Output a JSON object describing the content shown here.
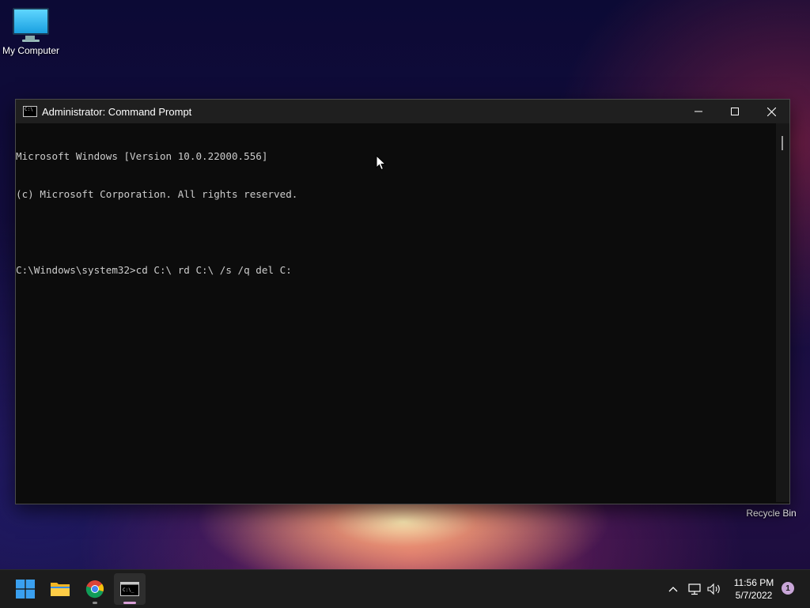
{
  "desktop": {
    "icons": [
      {
        "label": "My Computer",
        "icon": "monitor-icon"
      },
      {
        "label": "Recycle Bin",
        "icon": "recycle-bin-icon"
      }
    ]
  },
  "window": {
    "title": "Administrator: Command Prompt",
    "icon": "cmd-icon",
    "controls": {
      "minimize": "minimize-icon",
      "maximize": "maximize-icon",
      "close": "close-icon"
    }
  },
  "console": {
    "lines": [
      "Microsoft Windows [Version 10.0.22000.556]",
      "(c) Microsoft Corporation. All rights reserved.",
      "",
      "C:\\Windows\\system32>cd C:\\ rd C:\\ /s /q del C:"
    ]
  },
  "taskbar": {
    "apps": [
      {
        "name": "start",
        "icon": "windows-logo-icon"
      },
      {
        "name": "file-explorer",
        "icon": "folder-icon"
      },
      {
        "name": "chrome",
        "icon": "chrome-icon"
      },
      {
        "name": "command-prompt",
        "icon": "cmd-icon",
        "active": true
      }
    ],
    "tray": {
      "icons": [
        "chevron-up-icon",
        "network-icon",
        "volume-icon"
      ],
      "time": "11:56 PM",
      "date": "5/7/2022",
      "notification_count": "1"
    }
  },
  "colors": {
    "console_bg": "#0c0c0c",
    "console_text": "#cccccc",
    "titlebar_bg": "#1f1f1f",
    "taskbar_bg": "#1c1c1c",
    "active_indicator": "#d9a0d8"
  }
}
